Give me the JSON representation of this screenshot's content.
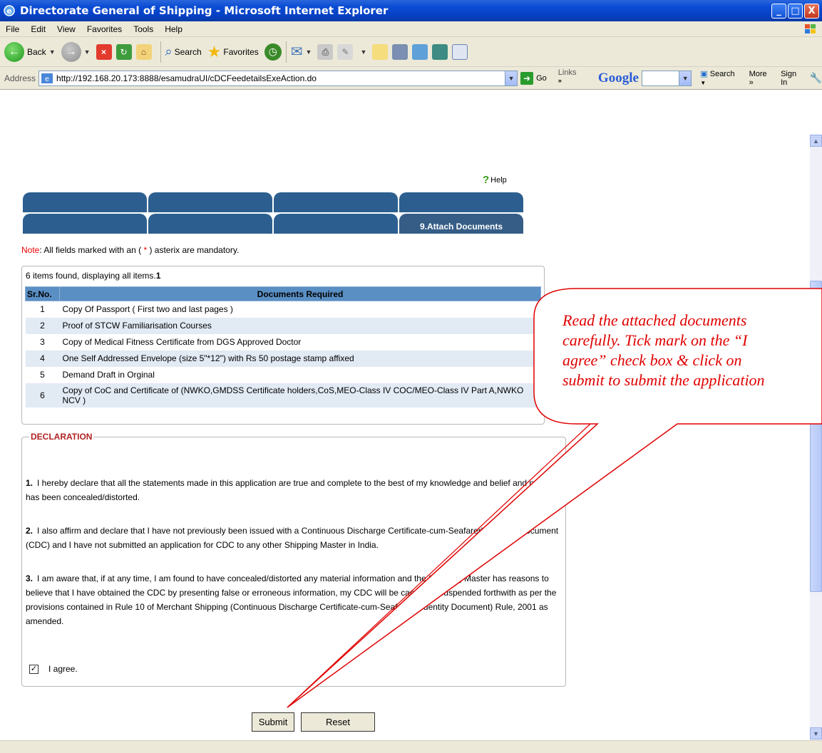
{
  "window": {
    "title": "Directorate General of Shipping - Microsoft Internet Explorer",
    "controls": [
      "_",
      "□",
      "X"
    ]
  },
  "menu": [
    "File",
    "Edit",
    "View",
    "Favorites",
    "Tools",
    "Help"
  ],
  "toolbar": {
    "back_label": "Back",
    "search_label": "Search",
    "favorites_label": "Favorites"
  },
  "address": {
    "label": "Address",
    "url": "http://192.168.20.173:8888/esamudraUI/cDCFeedetailsExeAction.do",
    "go_label": "Go",
    "links_label": "Links",
    "links_chevron": "»",
    "google_logo": "Google",
    "google_search_label": "Search",
    "google_more_label": "More »",
    "google_signin_label": "Sign In"
  },
  "page": {
    "help_label": "Help",
    "tabs": [
      "",
      "",
      "",
      "",
      "",
      "",
      "",
      "9.Attach Documents"
    ],
    "note_prefix": "Note",
    "note_middle": ": All fields marked with an (",
    "note_asterisk": "*",
    "note_suffix": ") asterix are mandatory.",
    "docs_summary": "6 items found, displaying all items.",
    "docs_page": "1",
    "docs_headers": [
      "Sr.No.",
      "Documents Required"
    ],
    "documents": [
      {
        "sr": "1",
        "text": "Copy Of Passport ( First two and last pages )"
      },
      {
        "sr": "2",
        "text": "Proof of STCW Familiarisation Courses"
      },
      {
        "sr": "3",
        "text": "Copy of Medical Fitness Certificate from DGS Approved Doctor"
      },
      {
        "sr": "4",
        "text": "One Self Addressed Envelope (size 5\"*12\") with Rs 50 postage stamp affixed"
      },
      {
        "sr": "5",
        "text": "Demand Draft in Orginal"
      },
      {
        "sr": "6",
        "text": "Copy of CoC and Certificate of (NWKO,GMDSS Certificate holders,CoS,MEO-Class IV COC/MEO-Class IV Part A,NWKO NCV )"
      }
    ],
    "declaration_title": "DECLARATION",
    "declarations": [
      {
        "num": "1.",
        "text": "I hereby declare that all the statements made in this application are true and complete to the best of my knowledge and belief and nothing has been concealed/distorted."
      },
      {
        "num": "2.",
        "text": "I also affirm and declare that I have not previously been issued with a Continuous Discharge Certificate-cum-Seafarer's Identity Document (CDC) and I have not submitted an application for CDC to any other Shipping Master in India."
      },
      {
        "num": "3.",
        "text": "I am aware that, if at any time, I am found to have concealed/distorted any material information and the Shipping Master has reasons to believe that I have obtained the CDC by presenting false or erroneous information, my CDC will be cancelled/suspended forthwith as per the provisions contained in Rule 10 of Merchant Shipping (Continuous Discharge Certificate-cum-Seafarer's Identity Document) Rule, 2001 as amended."
      }
    ],
    "agree_label": "I agree.",
    "agree_checked": "✓",
    "submit_label": "Submit",
    "reset_label": "Reset"
  },
  "callout": {
    "lines": [
      "Read the attached documents",
      "carefully. Tick mark on the “I",
      "agree” check box & click on",
      "submit to submit the application"
    ],
    "color": "#e00000"
  }
}
